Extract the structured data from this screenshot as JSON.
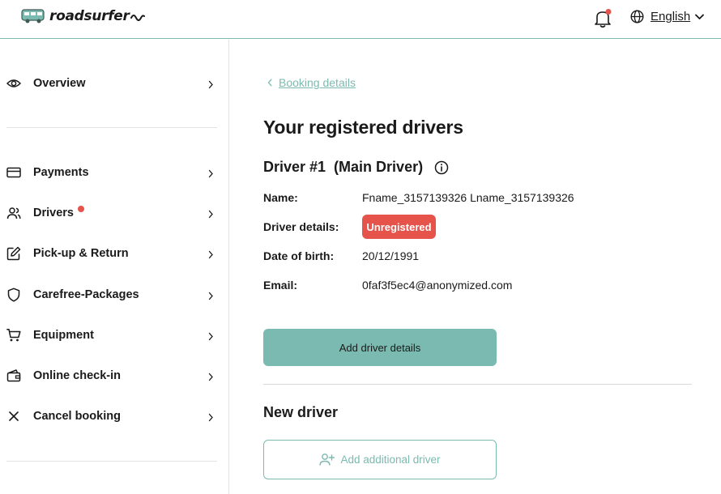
{
  "header": {
    "logo_text": "roadsurfer",
    "language": "English",
    "notification_dot_color": "#e5534b"
  },
  "sidebar": {
    "items": [
      {
        "label": "Overview",
        "icon": "eye-icon"
      },
      {
        "label": "Payments",
        "icon": "credit-card-icon"
      },
      {
        "label": "Drivers",
        "icon": "users-icon",
        "has_alert_dot": true
      },
      {
        "label": "Pick-up & Return",
        "icon": "edit-icon"
      },
      {
        "label": "Carefree-Packages",
        "icon": "shield-icon"
      },
      {
        "label": "Equipment",
        "icon": "cart-icon"
      },
      {
        "label": "Online check-in",
        "icon": "wallet-icon"
      },
      {
        "label": "Cancel booking",
        "icon": "close-icon"
      }
    ]
  },
  "main": {
    "breadcrumb": "Booking details",
    "page_title": "Your registered drivers",
    "driver": {
      "heading": "Driver #1  (Main Driver)",
      "name_label": "Name:",
      "name_value": "Fname_3157139326 Lname_3157139326",
      "details_label": "Driver details:",
      "details_status": "Unregistered",
      "dob_label": "Date of birth:",
      "dob_value": "20/12/1991",
      "email_label": "Email:",
      "email_value": "0faf3f5ec4@anonymized.com"
    },
    "add_details_button": "Add driver details",
    "new_driver_title": "New driver",
    "add_additional_button": "Add additional driver"
  },
  "colors": {
    "accent": "#7bbab0",
    "danger": "#e5534b"
  }
}
